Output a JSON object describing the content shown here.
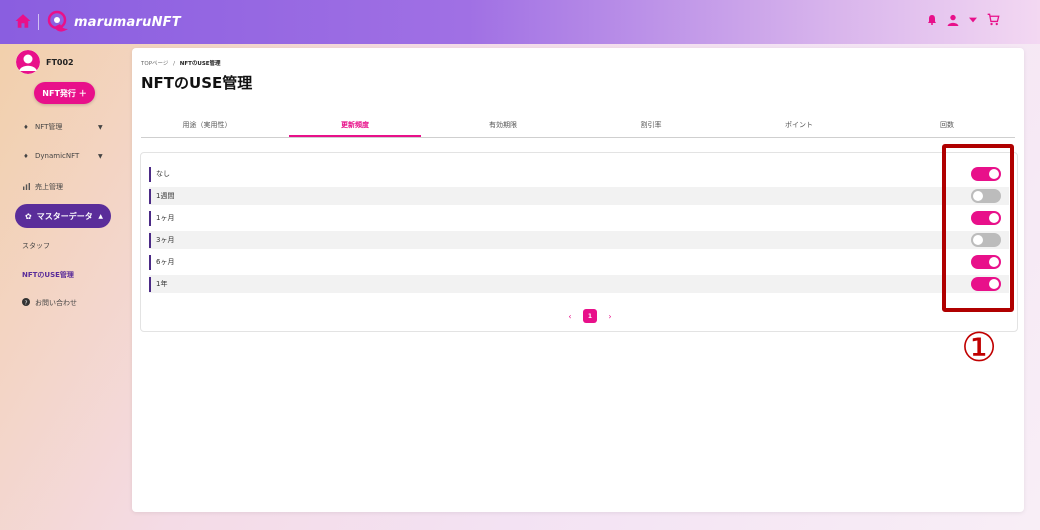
{
  "header": {
    "logo_text": "marumaruNFT",
    "icons": [
      "home-icon",
      "bell-icon",
      "user-icon",
      "chevron-down-icon",
      "cart-icon"
    ]
  },
  "sidebar": {
    "user_name": "FT002",
    "nft_button": "NFT発行 ＋",
    "items": [
      {
        "label": "NFT管理",
        "icon": "diamond-icon"
      },
      {
        "label": "DynamicNFT",
        "icon": "diamond-icon"
      },
      {
        "label": "売上管理",
        "icon": "chart-icon"
      }
    ],
    "active": {
      "label": "マスターデータ",
      "icon": "gear-icon"
    },
    "sub_items": [
      {
        "label": "スタッフ"
      },
      {
        "label": "NFTのUSE管理"
      }
    ],
    "contact": {
      "label": "お問い合わせ",
      "icon": "question-icon"
    }
  },
  "main": {
    "breadcrumb_home": "TOPページ",
    "breadcrumb_sep": "/",
    "breadcrumb_current": "NFTのUSE管理",
    "title": "NFTのUSE管理",
    "tabs": [
      {
        "label": "用途（実用性）",
        "active": false
      },
      {
        "label": "更新頻度",
        "active": true
      },
      {
        "label": "有効期限",
        "active": false
      },
      {
        "label": "割引率",
        "active": false
      },
      {
        "label": "ポイント",
        "active": false
      },
      {
        "label": "回数",
        "active": false
      }
    ],
    "rows": [
      {
        "label": "なし",
        "enabled": true
      },
      {
        "label": "1週間",
        "enabled": false
      },
      {
        "label": "1ヶ月",
        "enabled": true
      },
      {
        "label": "3ヶ月",
        "enabled": false
      },
      {
        "label": "6ヶ月",
        "enabled": true
      },
      {
        "label": "1年",
        "enabled": true
      }
    ],
    "pagination": {
      "prev": "‹",
      "current": "1",
      "next": "›"
    }
  },
  "annotation": {
    "number": "①",
    "color": "#c00000"
  },
  "colors": {
    "accent": "#e8108a",
    "active_nav": "#5a2d9a",
    "toggle_off": "#bcbcbc"
  }
}
